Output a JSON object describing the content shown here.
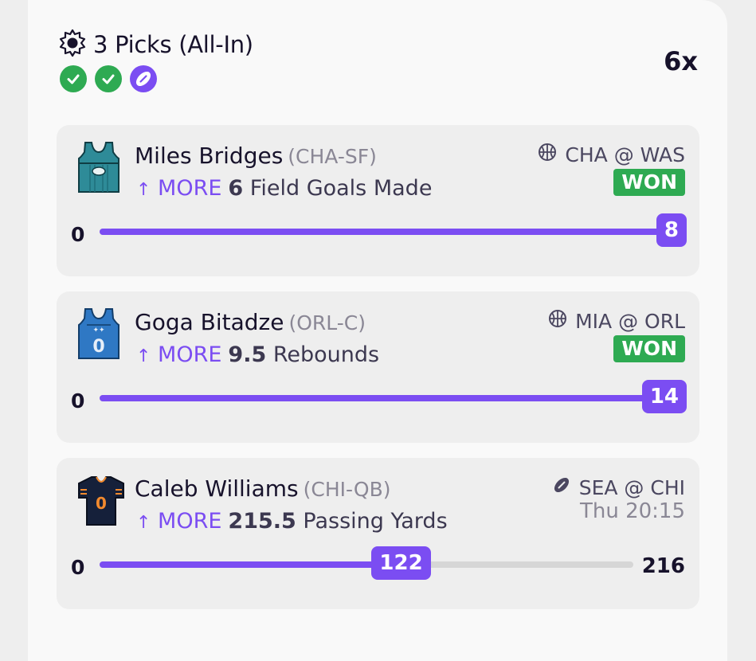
{
  "header": {
    "title": "3 Picks (All-In)",
    "multiplier": "6x",
    "status_icons": [
      "check-icon",
      "check-icon",
      "football-icon"
    ],
    "colors": {
      "won": "#2eaa52",
      "accent": "#7b4df2"
    }
  },
  "picks": [
    {
      "player": "Miles Bridges",
      "position": "(CHA-SF)",
      "direction_arrow": "↑",
      "direction": "MORE",
      "line": "6",
      "stat": "Field Goals Made",
      "sport_icon": "basketball-icon",
      "game": "CHA @ WAS",
      "result": "WON",
      "bar_min": "0",
      "bar_max": "",
      "current": "8",
      "progress": 1.0
    },
    {
      "player": "Goga Bitadze",
      "position": "(ORL-C)",
      "direction_arrow": "↑",
      "direction": "MORE",
      "line": "9.5",
      "stat": "Rebounds",
      "sport_icon": "basketball-icon",
      "game": "MIA @ ORL",
      "result": "WON",
      "bar_min": "0",
      "bar_max": "",
      "current": "14",
      "progress": 1.0
    },
    {
      "player": "Caleb Williams",
      "position": "(CHI-QB)",
      "direction_arrow": "↑",
      "direction": "MORE",
      "line": "215.5",
      "stat": "Passing Yards",
      "sport_icon": "football-icon",
      "game": "SEA @ CHI",
      "time": "Thu 20:15",
      "bar_min": "0",
      "bar_max": "216",
      "current": "122",
      "progress": 0.565
    }
  ]
}
